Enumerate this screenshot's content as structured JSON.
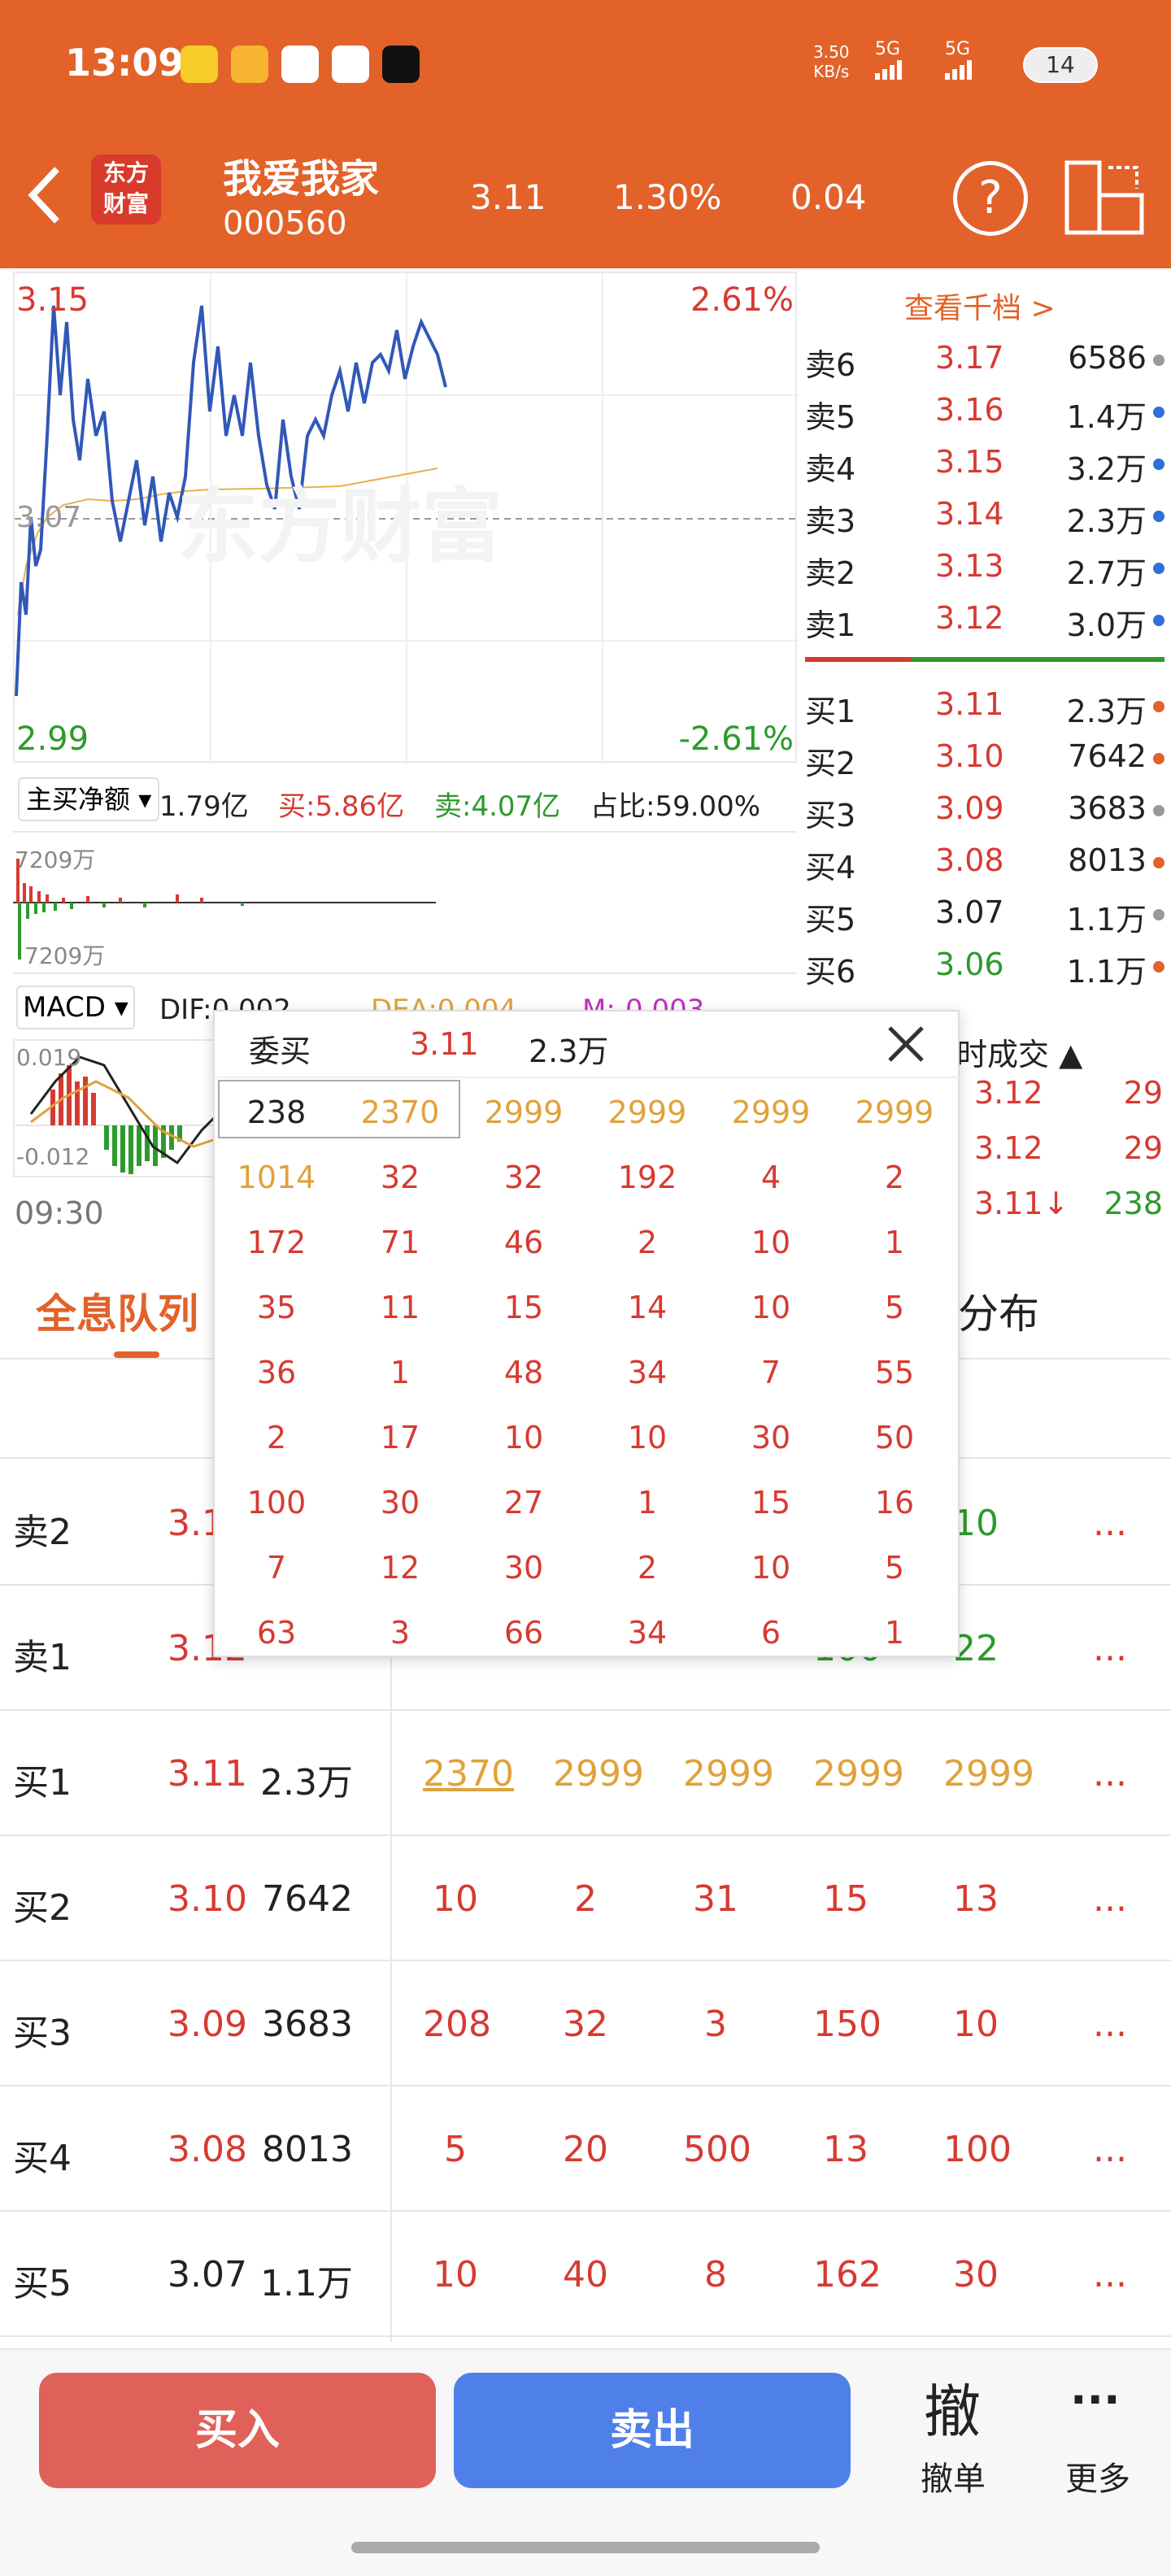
{
  "status_bar": {
    "time": "13:09",
    "net_speed": "3.50",
    "net_unit": "KB/s",
    "signal1": "5G",
    "signal2": "5G",
    "battery": "14"
  },
  "header": {
    "logo_line1": "东方",
    "logo_line2": "财富",
    "stock_name": "我爱我家",
    "stock_code": "000560",
    "price": "3.11",
    "change_pct": "1.30%",
    "change": "0.04"
  },
  "chart": {
    "high_price": "3.15",
    "high_pct": "2.61%",
    "low_price": "2.99",
    "low_pct": "-2.61%",
    "ref_price": "3.07",
    "watermark": "东方财富",
    "time_label": "09:30"
  },
  "fund_flow": {
    "selector": "主买净额",
    "net": "1.79亿",
    "buy": "买:5.86亿",
    "sell": "卖:4.07亿",
    "ratio": "占比:59.00%",
    "top_label": "7209万",
    "bottom_label": "7209万"
  },
  "macd": {
    "selector": "MACD",
    "dif": "DIF:0.002",
    "dea": "DEA:0.004",
    "m": "M:-0.003",
    "top_val": "0.019",
    "bottom_val": "-0.012"
  },
  "orderbook": {
    "title": "查看千档 >",
    "sells": [
      {
        "label": "卖6",
        "price": "3.17",
        "vol": "6586",
        "dot": "#999999"
      },
      {
        "label": "卖5",
        "price": "3.16",
        "vol": "1.4万",
        "dot": "#2e6fd8"
      },
      {
        "label": "卖4",
        "price": "3.15",
        "vol": "3.2万",
        "dot": "#2e6fd8"
      },
      {
        "label": "卖3",
        "price": "3.14",
        "vol": "2.3万",
        "dot": "#2e6fd8"
      },
      {
        "label": "卖2",
        "price": "3.13",
        "vol": "2.7万",
        "dot": "#2e6fd8"
      },
      {
        "label": "卖1",
        "price": "3.12",
        "vol": "3.0万",
        "dot": "#2e6fd8"
      }
    ],
    "buys": [
      {
        "label": "买1",
        "price": "3.11",
        "vol": "2.3万",
        "dot": "#e2622a"
      },
      {
        "label": "买2",
        "price": "3.10",
        "vol": "7642",
        "dot": "#e2622a"
      },
      {
        "label": "买3",
        "price": "3.09",
        "vol": "3683",
        "dot": "#999999"
      },
      {
        "label": "买4",
        "price": "3.08",
        "vol": "8013",
        "dot": "#e2622a"
      },
      {
        "label": "买5",
        "price": "3.07",
        "vol": "1.1万",
        "dot": "#999999"
      },
      {
        "label": "买6",
        "price": "3.06",
        "vol": "1.1万",
        "dot": "#e2622a"
      }
    ],
    "trades_title": "时成交",
    "trades": [
      {
        "price": "3.12",
        "vol": "29"
      },
      {
        "price": "3.12",
        "vol": "29"
      },
      {
        "price": "3.11↓",
        "vol": "238"
      }
    ]
  },
  "tabs": {
    "active": "全息队列",
    "dist": "分布"
  },
  "popup": {
    "title": "委买",
    "price": "3.11",
    "vol": "2.3万",
    "rows": [
      [
        "238",
        "2370",
        "2999",
        "2999",
        "2999",
        "2999"
      ],
      [
        "1014",
        "32",
        "32",
        "192",
        "4",
        "2"
      ],
      [
        "172",
        "71",
        "46",
        "2",
        "10",
        "1"
      ],
      [
        "35",
        "11",
        "15",
        "14",
        "10",
        "5"
      ],
      [
        "36",
        "1",
        "48",
        "34",
        "7",
        "55"
      ],
      [
        "2",
        "17",
        "10",
        "10",
        "30",
        "50"
      ],
      [
        "100",
        "30",
        "27",
        "1",
        "15",
        "16"
      ],
      [
        "7",
        "12",
        "30",
        "2",
        "10",
        "5"
      ],
      [
        "63",
        "3",
        "66",
        "34",
        "6",
        "1"
      ]
    ]
  },
  "queue": [
    {
      "label": "卖2",
      "price": "3.13",
      "vol": "",
      "vals": [
        "",
        "",
        "",
        "",
        "10"
      ]
    },
    {
      "label": "卖1",
      "price": "3.12",
      "vol": "",
      "vals": [
        "",
        "",
        "",
        "100",
        "22"
      ]
    },
    {
      "label": "买1",
      "price": "3.11",
      "vol": "2.3万",
      "vals": [
        "2370",
        "2999",
        "2999",
        "2999",
        "2999"
      ]
    },
    {
      "label": "买2",
      "price": "3.10",
      "vol": "7642",
      "vals": [
        "10",
        "2",
        "31",
        "15",
        "13"
      ]
    },
    {
      "label": "买3",
      "price": "3.09",
      "vol": "3683",
      "vals": [
        "208",
        "32",
        "3",
        "150",
        "10"
      ]
    },
    {
      "label": "买4",
      "price": "3.08",
      "vol": "8013",
      "vals": [
        "5",
        "20",
        "500",
        "13",
        "100"
      ]
    },
    {
      "label": "买5",
      "price": "3.07",
      "vol": "1.1万",
      "vals": [
        "10",
        "40",
        "8",
        "162",
        "30"
      ]
    }
  ],
  "queue_more": "...",
  "bottom": {
    "buy": "买入",
    "sell": "卖出",
    "cancel_icon": "撤",
    "cancel": "撤单",
    "more_icon": "···",
    "more": "更多"
  }
}
